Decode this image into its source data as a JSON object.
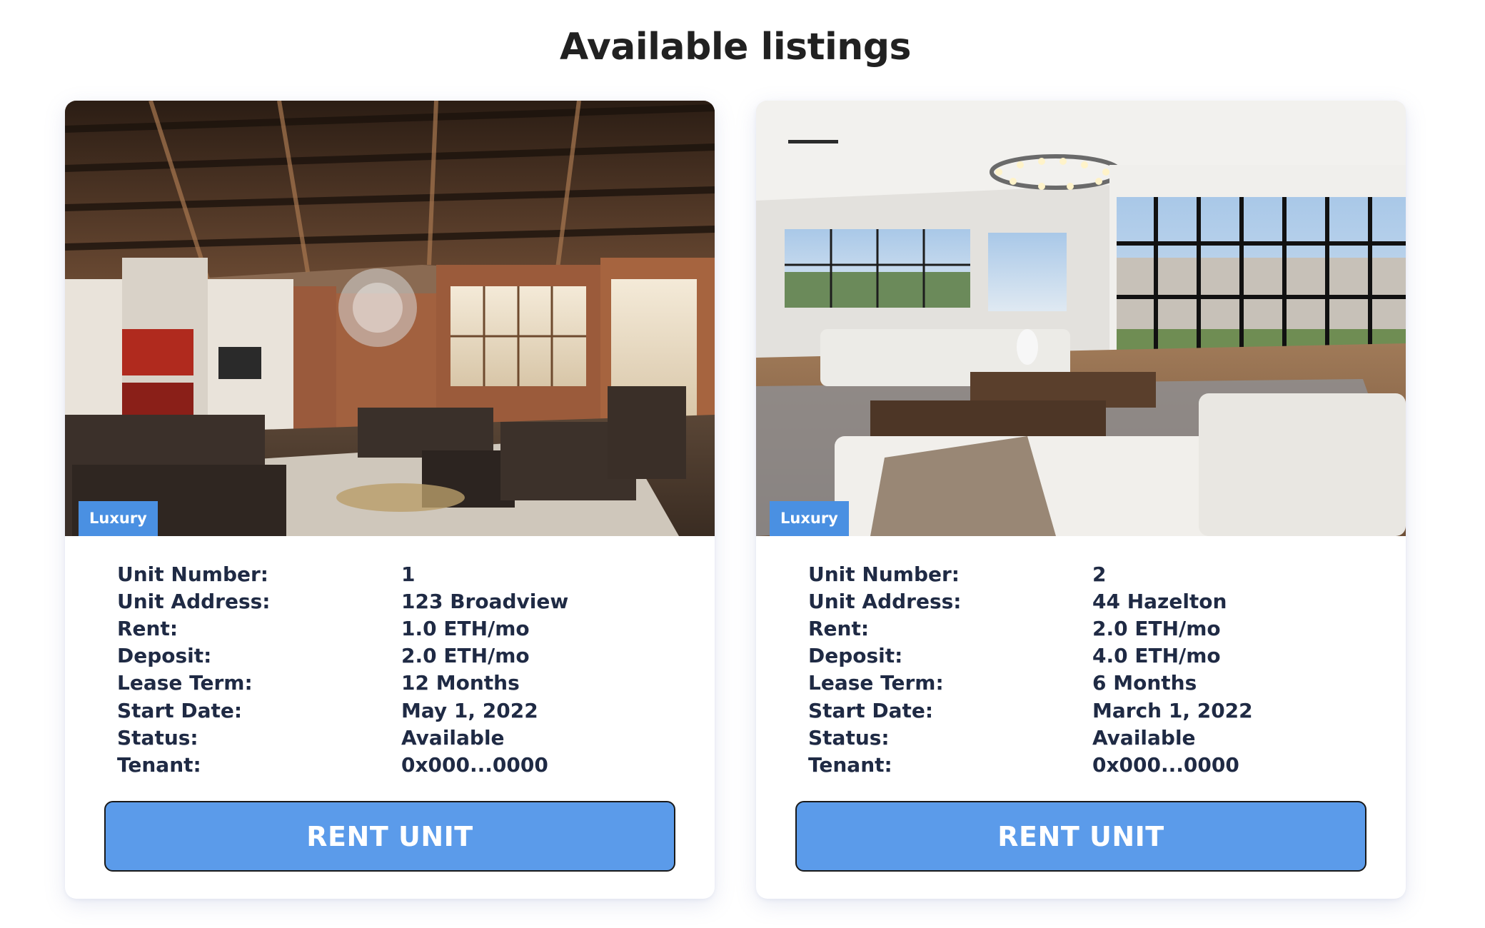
{
  "page": {
    "title": "Available listings"
  },
  "listings": [
    {
      "badge": "Luxury",
      "fields": [
        {
          "label": "Unit Number:",
          "value": "1"
        },
        {
          "label": "Unit Address:",
          "value": "123 Broadview"
        },
        {
          "label": "Rent:",
          "value": "1.0 ETH/mo"
        },
        {
          "label": "Deposit:",
          "value": "2.0 ETH/mo"
        },
        {
          "label": "Lease Term:",
          "value": "12 Months"
        },
        {
          "label": "Start Date:",
          "value": "May 1, 2022"
        },
        {
          "label": "Status:",
          "value": "Available"
        },
        {
          "label": "Tenant:",
          "value": "0x000...0000"
        }
      ],
      "button_label": "RENT UNIT"
    },
    {
      "badge": "Luxury",
      "fields": [
        {
          "label": "Unit Number:",
          "value": "2"
        },
        {
          "label": "Unit Address:",
          "value": "44 Hazelton"
        },
        {
          "label": "Rent:",
          "value": "2.0 ETH/mo"
        },
        {
          "label": "Deposit:",
          "value": "4.0 ETH/mo"
        },
        {
          "label": "Lease Term:",
          "value": "6 Months"
        },
        {
          "label": "Start Date:",
          "value": "March 1, 2022"
        },
        {
          "label": "Status:",
          "value": "Available"
        },
        {
          "label": "Tenant:",
          "value": "0x000...0000"
        }
      ],
      "button_label": "RENT UNIT"
    }
  ],
  "colors": {
    "badge": "#4a90e2",
    "button": "#5b9bea",
    "text": "#1f2a44"
  }
}
